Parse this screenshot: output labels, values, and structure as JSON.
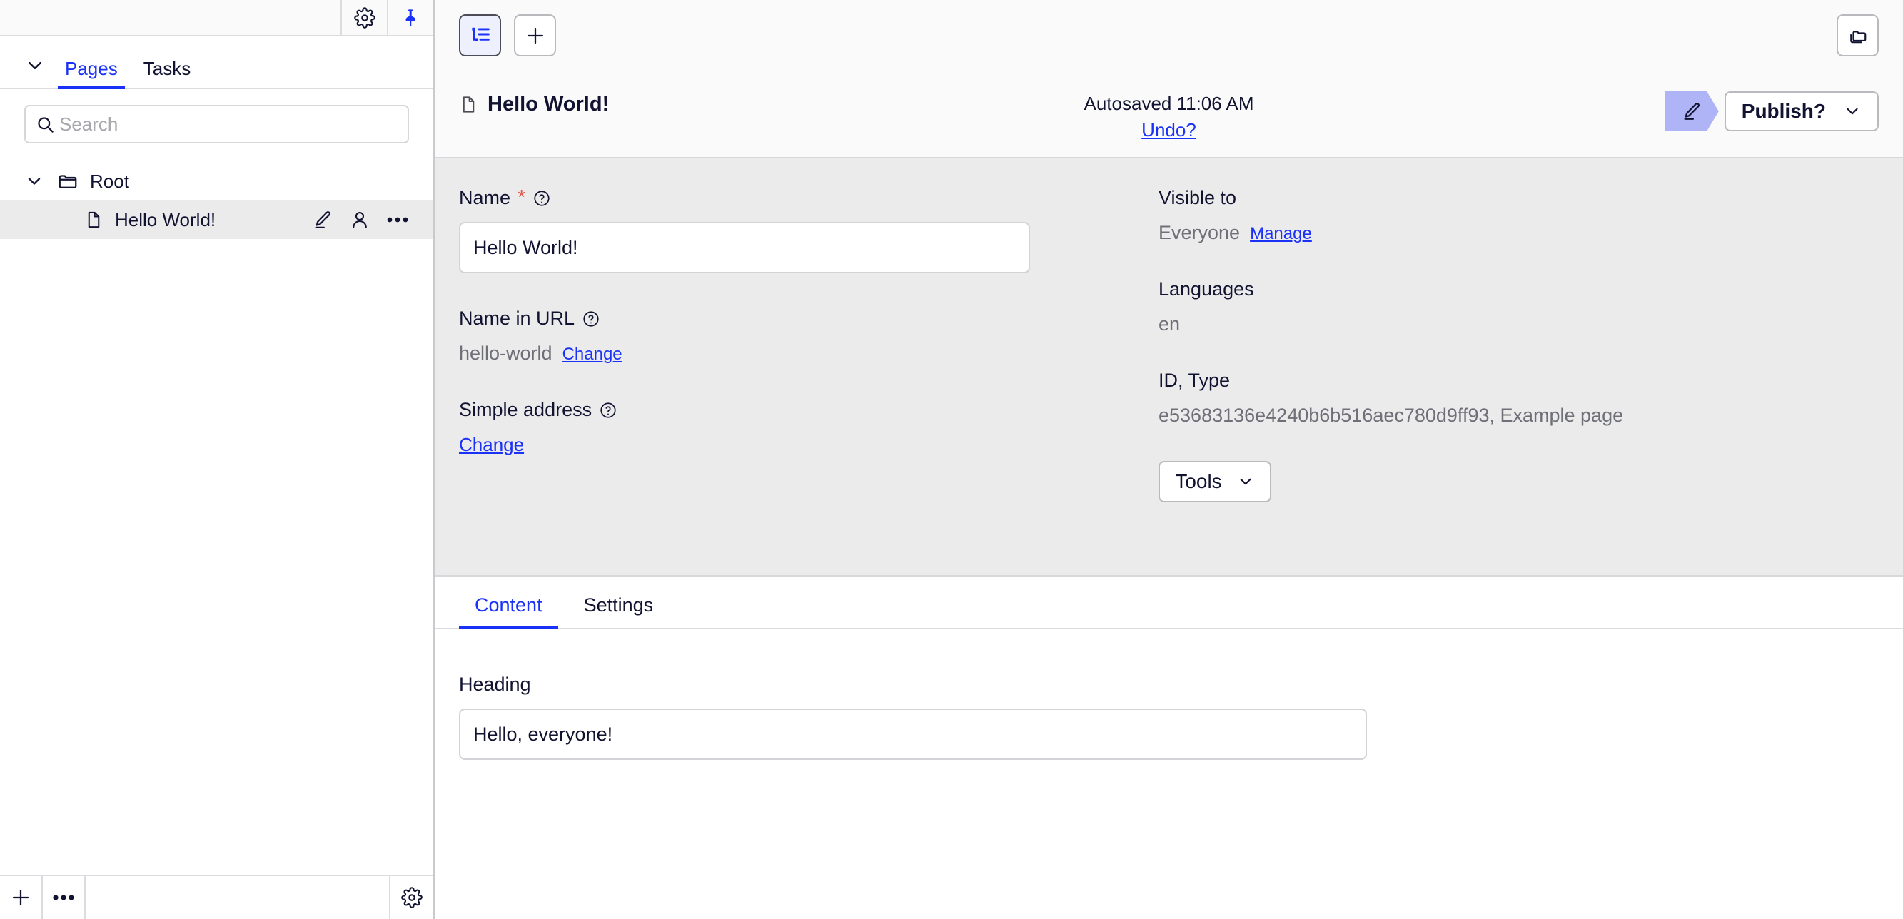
{
  "sidebar": {
    "topbar": {
      "settings_icon": "gear-icon",
      "pin_icon": "pin-icon"
    },
    "collapse_icon": "chevron-down-icon",
    "tabs": [
      {
        "label": "Pages",
        "active": true
      },
      {
        "label": "Tasks",
        "active": false
      }
    ],
    "search": {
      "placeholder": "Search",
      "value": "",
      "icon": "search-icon"
    },
    "tree": [
      {
        "label": "Root",
        "type": "folder",
        "icon": "folder-icon",
        "chevron": "chevron-down-icon",
        "selected": false
      },
      {
        "label": "Hello World!",
        "type": "page",
        "icon": "page-icon",
        "selected": true,
        "actions": [
          "pencil-icon",
          "user-icon",
          "more-horizontal-icon"
        ]
      }
    ],
    "bottom": {
      "add_label": "+",
      "more_label": "•••",
      "settings_icon": "gear-icon"
    }
  },
  "main": {
    "toolbar": {
      "tree_view_icon": "tree-list-icon",
      "add_icon": "plus-icon",
      "copy_folders_icon": "copy-folders-icon"
    },
    "header": {
      "page_icon": "page-icon",
      "title": "Hello World!",
      "autosaved": "Autosaved 11:06 AM",
      "undo_label": "Undo?",
      "edit_badge_icon": "pencil-icon",
      "publish_label": "Publish?",
      "publish_chevron": "chevron-down-icon"
    },
    "info": {
      "name": {
        "label": "Name",
        "required_mark": "*",
        "help_icon": "question-circle-icon",
        "value": "Hello World!"
      },
      "name_in_url": {
        "label": "Name in URL",
        "help_icon": "question-circle-icon",
        "value": "hello-world",
        "change_label": "Change"
      },
      "simple_address": {
        "label": "Simple address",
        "help_icon": "question-circle-icon",
        "change_label": "Change"
      },
      "visible_to": {
        "label": "Visible to",
        "value": "Everyone",
        "manage_label": "Manage"
      },
      "languages": {
        "label": "Languages",
        "value": "en"
      },
      "id_type": {
        "label": "ID, Type",
        "value": "e53683136e4240b6b516aec780d9ff93, Example page"
      },
      "tools": {
        "label": "Tools",
        "chevron": "chevron-down-icon"
      }
    },
    "tabs": [
      {
        "label": "Content",
        "active": true
      },
      {
        "label": "Settings",
        "active": false
      }
    ],
    "content": {
      "heading_label": "Heading",
      "heading_value": "Hello, everyone!"
    }
  },
  "colors": {
    "accent": "#1a31f8",
    "ink": "#121331",
    "panel_gray": "#ebebec",
    "badge_lavender": "#aeb4f5",
    "required_red": "#e2564c",
    "muted": "#6f6f78"
  }
}
